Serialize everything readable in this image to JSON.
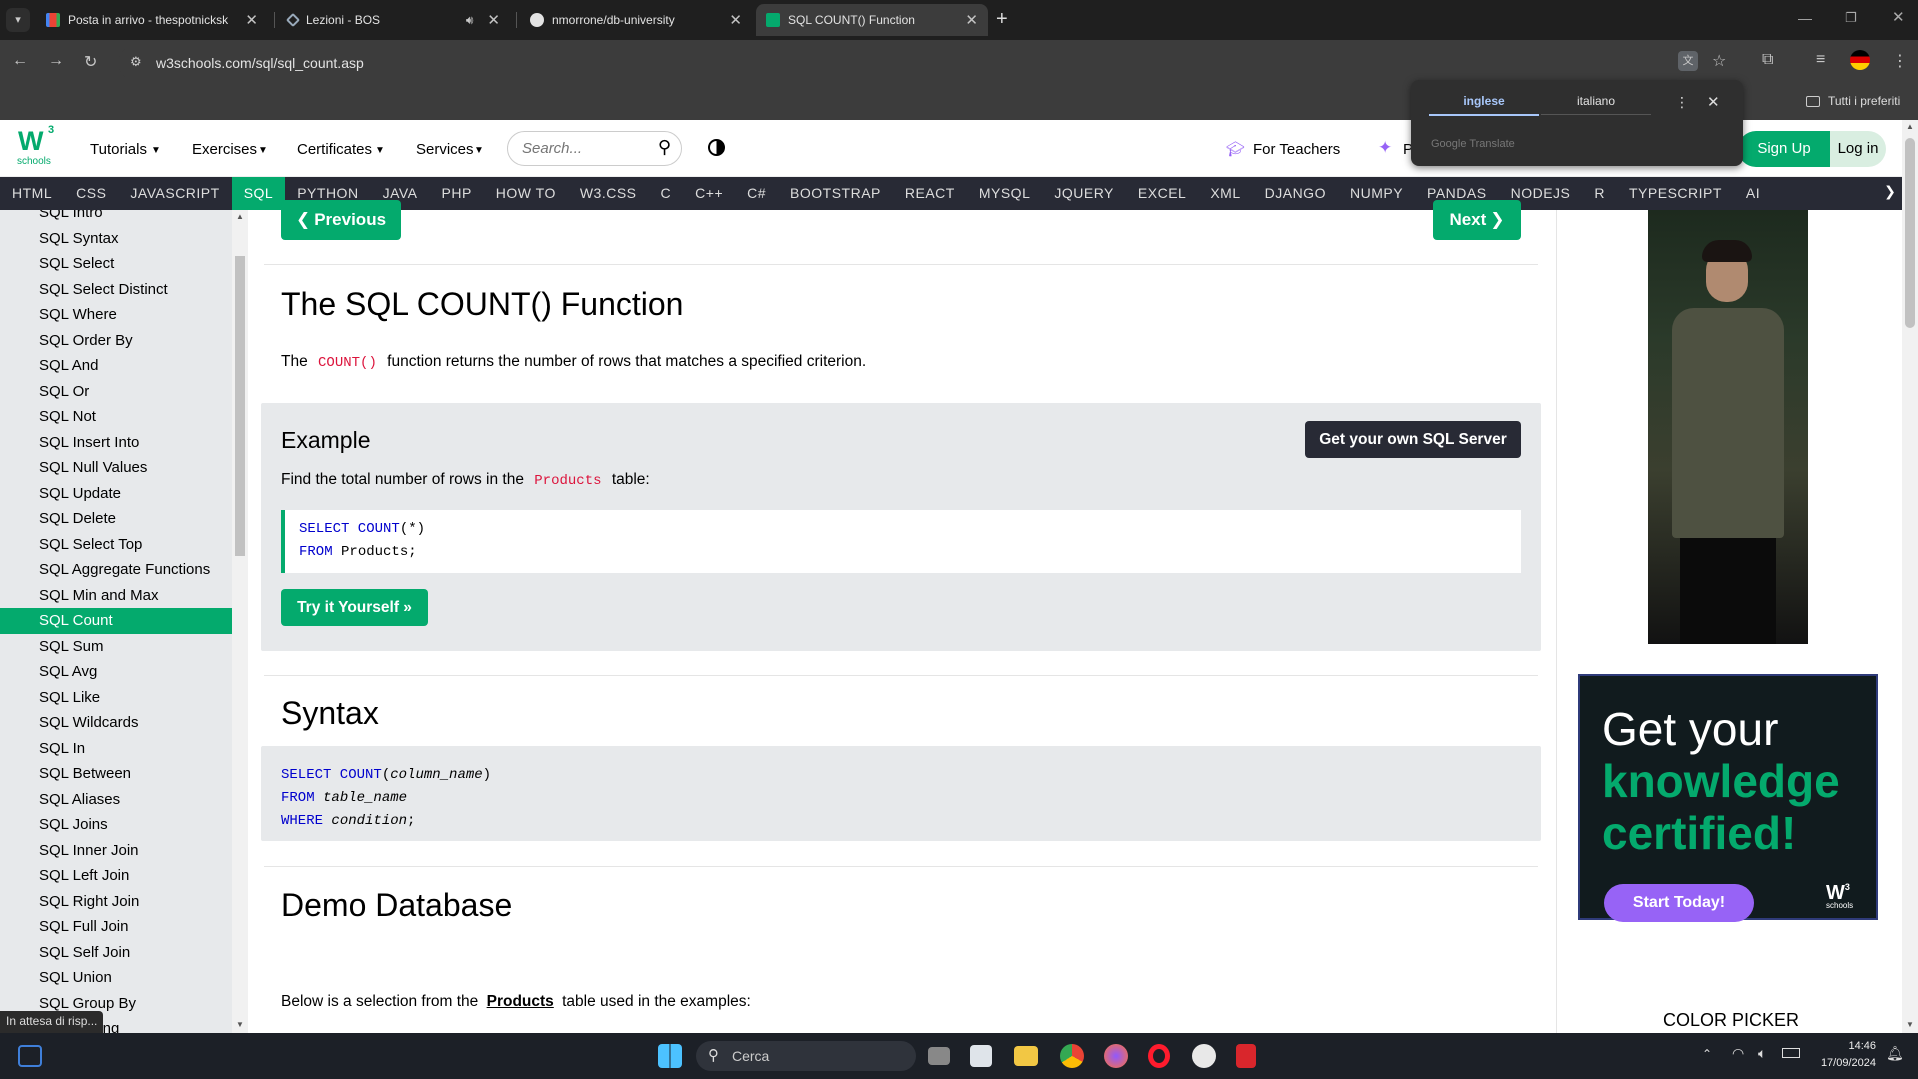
{
  "browser": {
    "tabs": [
      {
        "title": "Posta in arrivo - thespotnicksk",
        "icon": "gmail-icon",
        "active": false
      },
      {
        "title": "Lezioni - BOS",
        "icon": "bos-icon",
        "active": false
      },
      {
        "title": "nmorrone/db-university",
        "icon": "github-icon",
        "active": false
      },
      {
        "title": "SQL COUNT() Function",
        "icon": "w3schools-icon",
        "active": true
      }
    ],
    "url": "w3schools.com/sql/sql_count.asp",
    "bookmarks_label": "Tutti i preferiti"
  },
  "translate": {
    "lang_from": "inglese",
    "lang_to": "italiano",
    "footer": "Google Translate"
  },
  "header": {
    "logo_sub": "schools",
    "logo_main": "W",
    "logo_sup": "3",
    "nav": [
      "Tutorials",
      "Exercises",
      "Certificates",
      "Services"
    ],
    "search_placeholder": "Search...",
    "for_teachers": "For Teachers",
    "plus_label": "P",
    "sign_up": "Sign Up",
    "log_in": "Log in"
  },
  "topnav": [
    "HTML",
    "CSS",
    "JAVASCRIPT",
    "SQL",
    "PYTHON",
    "JAVA",
    "PHP",
    "HOW TO",
    "W3.CSS",
    "C",
    "C++",
    "C#",
    "BOOTSTRAP",
    "REACT",
    "MYSQL",
    "JQUERY",
    "EXCEL",
    "XML",
    "DJANGO",
    "NUMPY",
    "PANDAS",
    "NODEJS",
    "R",
    "TYPESCRIPT",
    "AI"
  ],
  "topnav_active": "SQL",
  "sidebar": {
    "items": [
      "SQL Intro",
      "SQL Syntax",
      "SQL Select",
      "SQL Select Distinct",
      "SQL Where",
      "SQL Order By",
      "SQL And",
      "SQL Or",
      "SQL Not",
      "SQL Insert Into",
      "SQL Null Values",
      "SQL Update",
      "SQL Delete",
      "SQL Select Top",
      "SQL Aggregate Functions",
      "SQL Min and Max",
      "SQL Count",
      "SQL Sum",
      "SQL Avg",
      "SQL Like",
      "SQL Wildcards",
      "SQL In",
      "SQL Between",
      "SQL Aliases",
      "SQL Joins",
      "SQL Inner Join",
      "SQL Left Join",
      "SQL Right Join",
      "SQL Full Join",
      "SQL Self Join",
      "SQL Union",
      "SQL Group By",
      "SQL Having"
    ],
    "active": "SQL Count"
  },
  "main": {
    "prev": "Previous",
    "next": "Next",
    "title": "The SQL COUNT() Function",
    "intro_before": "The",
    "intro_code": "COUNT()",
    "intro_after": "function returns the number of rows that matches a specified criterion.",
    "example_title": "Example",
    "get_server": "Get your own SQL Server",
    "example_desc_before": "Find the total number of rows in the",
    "example_desc_code": "Products",
    "example_desc_after": "table:",
    "code1_line1_kw": "SELECT COUNT",
    "code1_line1_rest": "(*)",
    "code1_line2_kw": "FROM",
    "code1_line2_rest": " Products;",
    "try_it": "Try it Yourself »",
    "syntax_title": "Syntax",
    "syn_l1_kw": "SELECT COUNT",
    "syn_l1_arg": "column_name",
    "syn_l2_kw": "FROM",
    "syn_l2_arg": "table_name",
    "syn_l3_kw": "WHERE",
    "syn_l3_arg": "condition",
    "demo_title": "Demo Database",
    "demo_before": "Below is a selection from the",
    "demo_link": "Products",
    "demo_after": "table used in the examples:"
  },
  "ad": {
    "line1": "Get your",
    "line2": "knowledge",
    "line3": "certified!",
    "cta": "Start Today!",
    "color_picker": "COLOR PICKER"
  },
  "status_text": "In attesa di risp...",
  "taskbar": {
    "search": "Cerca",
    "time": "14:46",
    "date": "17/09/2024"
  },
  "colors": {
    "accent": "#04aa6d",
    "nav_bg": "#282a35",
    "sidebar_bg": "#e7e9eb",
    "ad_bg": "#111b1e",
    "ad_cta": "#9763f6"
  }
}
